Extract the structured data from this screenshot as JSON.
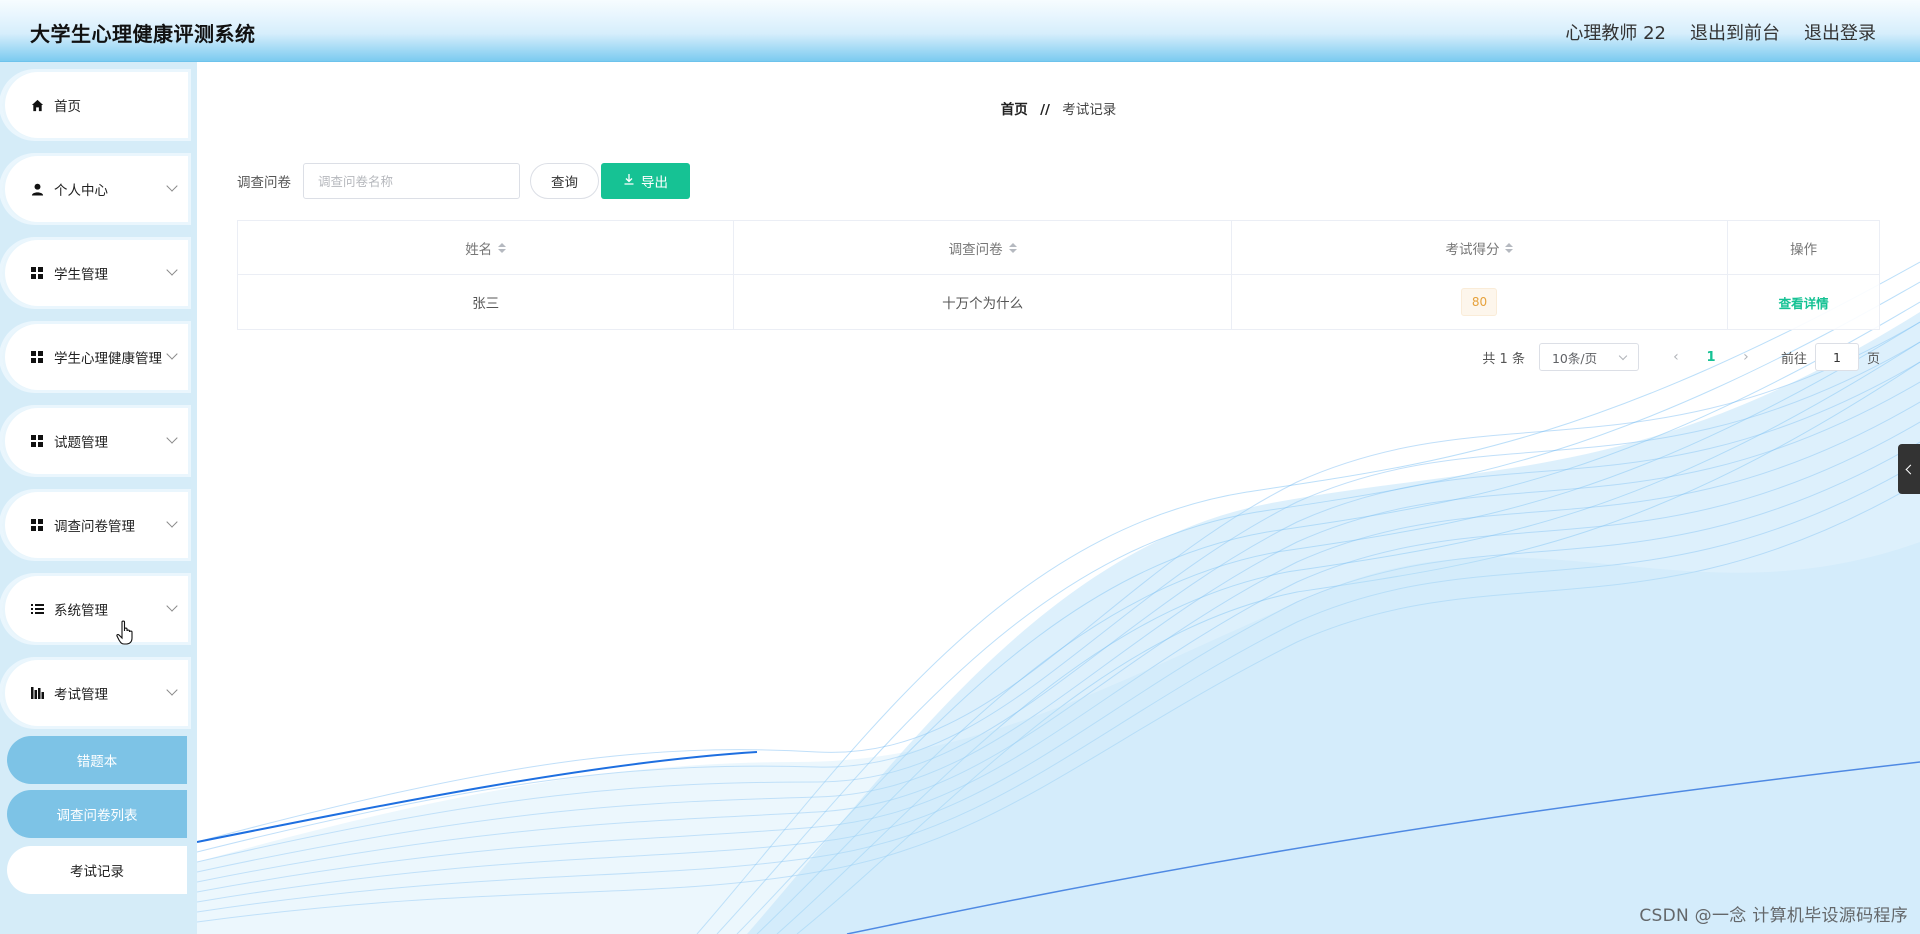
{
  "header": {
    "title": "大学生心理健康评测系统",
    "user": "心理教师 22",
    "to_front": "退出到前台",
    "logout": "退出登录"
  },
  "sidebar": {
    "items": [
      {
        "label": "首页",
        "icon": "home-icon"
      },
      {
        "label": "个人中心",
        "icon": "user-icon"
      },
      {
        "label": "学生管理",
        "icon": "grid-icon"
      },
      {
        "label": "学生心理健康管理",
        "icon": "grid-icon"
      },
      {
        "label": "试题管理",
        "icon": "grid-icon"
      },
      {
        "label": "调查问卷管理",
        "icon": "grid-icon"
      },
      {
        "label": "系统管理",
        "icon": "list-icon"
      },
      {
        "label": "考试管理",
        "icon": "chart-icon"
      }
    ],
    "subitems": [
      {
        "label": "错题本"
      },
      {
        "label": "调查问卷列表"
      },
      {
        "label": "考试记录"
      }
    ]
  },
  "breadcrumb": {
    "home": "首页",
    "sep": "//",
    "current": "考试记录"
  },
  "search": {
    "label": "调查问卷",
    "placeholder": "调查问卷名称",
    "query_btn": "查询",
    "export_btn": "导出"
  },
  "table": {
    "headers": [
      "姓名",
      "调查问卷",
      "考试得分",
      "操作"
    ],
    "rows": [
      {
        "name": "张三",
        "survey": "十万个为什么",
        "score": "80",
        "action": "查看详情"
      }
    ]
  },
  "pagination": {
    "total": "共 1 条",
    "page_size": "10条/页",
    "current": "1",
    "goto": "前往",
    "jump_value": "1",
    "page_unit": "页"
  },
  "watermark": "CSDN @一念 计算机毕设源码程序",
  "colors": {
    "accent": "#16c294",
    "sidebar_bg": "#d5ecf8",
    "sub_blue": "#7dc3e6",
    "score_tag": "#e6a23c"
  }
}
